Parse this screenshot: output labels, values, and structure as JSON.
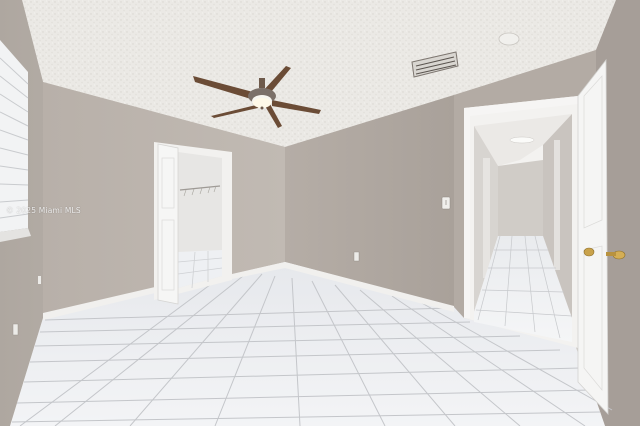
{
  "watermark": {
    "text": "© 2025 Miami MLS"
  },
  "colors": {
    "ceiling": "#eceae6",
    "left_wall": "#bfb8b1",
    "back_wall": "#aca39c",
    "right_back_wall": "#b6aea7",
    "right_wall": "#a79f99",
    "floor_tile": "#ecedef",
    "grout": "#c8c9cc",
    "door": "#f4f4f3",
    "trim": "#f2f1ef"
  },
  "icons": {
    "ceiling_fan": "ceiling-fan-icon",
    "vent": "ac-vent-icon",
    "smoke_detector": "smoke-detector-icon",
    "light_switch": "light-switch-icon",
    "outlet": "outlet-icon",
    "door_knob": "door-knob-icon"
  }
}
